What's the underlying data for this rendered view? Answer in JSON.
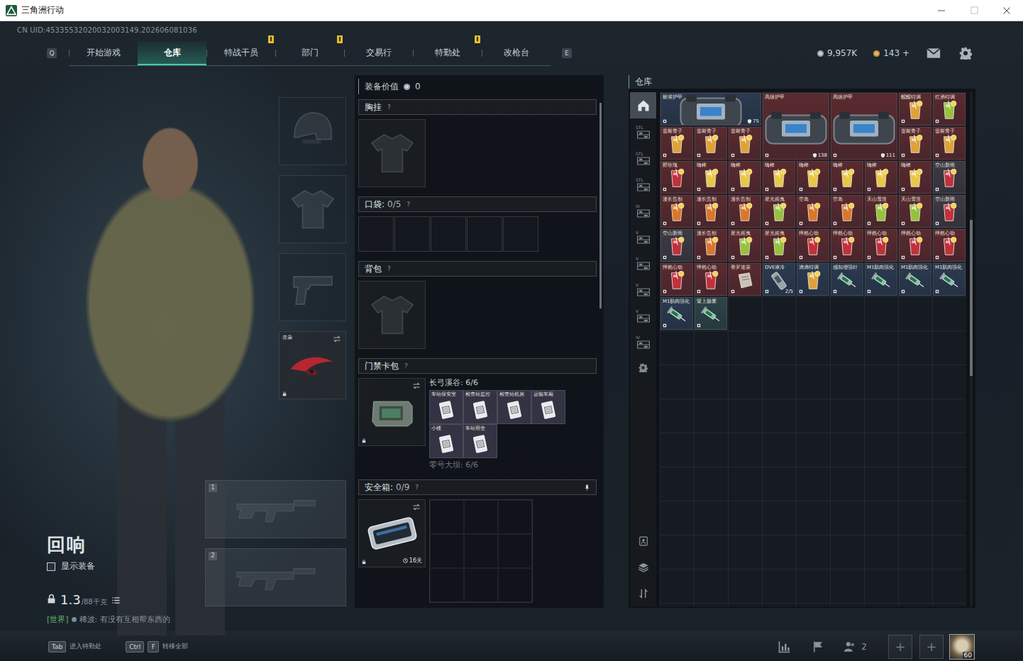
{
  "window": {
    "title": "三角洲行动"
  },
  "uid": "CN UID:45335532020032003149.202606081036",
  "nav": {
    "prev_key": "Q",
    "next_key": "E",
    "tabs": [
      {
        "label": "开始游戏",
        "selected": false,
        "badge": false
      },
      {
        "label": "仓库",
        "selected": true,
        "badge": false
      },
      {
        "label": "特战干员",
        "selected": false,
        "badge": true
      },
      {
        "label": "部门",
        "selected": false,
        "badge": true
      },
      {
        "label": "交易行",
        "selected": false,
        "badge": false
      },
      {
        "label": "特勤处",
        "selected": false,
        "badge": true
      },
      {
        "label": "改枪台",
        "selected": false,
        "badge": false
      }
    ]
  },
  "currency": [
    {
      "amount": "9,957K",
      "kind": "silver"
    },
    {
      "amount": "143 +",
      "kind": "gold"
    }
  ],
  "character": {
    "name": "回响",
    "show_equipment": {
      "label": "显示装备",
      "checked": false
    },
    "weight": "1.3",
    "weight_max": "/88千克"
  },
  "chat": {
    "channel": "[世界]",
    "sender": "稀波:",
    "message": "有没有互相帮东西的"
  },
  "gear_slots": [
    {
      "kind": "helmet",
      "filled": false
    },
    {
      "kind": "armor",
      "filled": false
    },
    {
      "kind": "pistol",
      "filled": false
    },
    {
      "kind": "melee",
      "filled": true,
      "label": "赤枭"
    }
  ],
  "weapon_slots": [
    {
      "number": "1",
      "filled": false
    },
    {
      "number": "2",
      "filled": false
    }
  ],
  "loadout": {
    "value_label": "装备价值",
    "value": "0",
    "chest": {
      "title": "胸挂",
      "help": "?",
      "filled": false
    },
    "pockets": {
      "title": "口袋:",
      "count": "0/5",
      "help": "?",
      "slots": [
        {
          "filled": false
        },
        {
          "filled": false
        },
        {
          "filled": false
        },
        {
          "filled": false
        },
        {
          "filled": false
        }
      ]
    },
    "backpack": {
      "title": "背包",
      "help": "?",
      "filled": false
    },
    "keycard": {
      "title": "门禁卡包",
      "help": "?",
      "groups": [
        {
          "name": "长弓溪谷: 6/6",
          "expanded": true,
          "cards": [
            {
              "label": "车站保安室"
            },
            {
              "label": "检查站监控"
            },
            {
              "label": "检查站机房"
            },
            {
              "label": "运输车厢"
            },
            {
              "label": "小楼"
            },
            {
              "label": "车站宿舍"
            }
          ]
        },
        {
          "name": "零号大坝: 6/6",
          "expanded": false,
          "cards": []
        }
      ]
    },
    "safe": {
      "title": "安全箱:",
      "count": "0/9",
      "help": "?",
      "expires": "16天",
      "pinned": true,
      "slots": [
        {
          "filled": false
        },
        {
          "filled": false
        },
        {
          "filled": false
        },
        {
          "filled": false
        },
        {
          "filled": false
        },
        {
          "filled": false
        },
        {
          "filled": false
        },
        {
          "filled": false
        },
        {
          "filled": false
        }
      ]
    }
  },
  "warehouse": {
    "title": "仓库",
    "tabs": [
      {
        "kind": "home",
        "label": "",
        "selected": true
      },
      {
        "kind": "shelf",
        "label": "STL",
        "selected": false
      },
      {
        "kind": "shelf",
        "label": "STL",
        "selected": false
      },
      {
        "kind": "shelf",
        "label": "STL",
        "selected": false
      },
      {
        "kind": "shelf",
        "label": "IV",
        "selected": false
      },
      {
        "kind": "shelf",
        "label": "V",
        "selected": false
      },
      {
        "kind": "shelf",
        "label": "V",
        "selected": false
      },
      {
        "kind": "shelf",
        "label": "V",
        "selected": false
      },
      {
        "kind": "shelf",
        "label": "V",
        "selected": false
      },
      {
        "kind": "shelf",
        "label": "IV",
        "selected": false
      },
      {
        "kind": "settings",
        "label": "",
        "selected": false
      }
    ],
    "items": [
      {
        "label": "标准护甲",
        "kind": "armor",
        "color": "#2b3a50",
        "cols": 3,
        "rows": 1,
        "durability": "75"
      },
      {
        "label": "高级护甲",
        "kind": "armor",
        "color": "#5a2a2f",
        "cols": 2,
        "rows": 2,
        "durability": "138"
      },
      {
        "label": "高级护甲",
        "kind": "armor",
        "color": "#5a2a2f",
        "cols": 2,
        "rows": 2,
        "durability": "111"
      },
      {
        "label": "醒醒特调",
        "kind": "drink",
        "color": "#5a2a2f",
        "cols": 1,
        "rows": 1
      },
      {
        "label": "红酒特调",
        "kind": "drink",
        "color": "#5a2a2f",
        "cols": 1,
        "rows": 1
      },
      {
        "label": "雷斯青子",
        "kind": "drink",
        "color": "#5a2a2f",
        "cols": 1,
        "rows": 1
      },
      {
        "label": "雷斯青子",
        "kind": "drink",
        "color": "#5a2a2f",
        "cols": 1,
        "rows": 1
      },
      {
        "label": "雷斯青子",
        "kind": "drink",
        "color": "#5a2a2f",
        "cols": 1,
        "rows": 1
      },
      {
        "label": "雷斯青子",
        "kind": "drink",
        "color": "#5a2a2f",
        "cols": 1,
        "rows": 1
      },
      {
        "label": "雷斯青子",
        "kind": "drink",
        "color": "#5a2a2f",
        "cols": 1,
        "rows": 1
      },
      {
        "label": "野玫瑰",
        "kind": "drink",
        "color": "#5a2a2f",
        "cols": 1,
        "rows": 1
      },
      {
        "label": "嗨棒",
        "kind": "drink",
        "color": "#5a2a2f",
        "cols": 1,
        "rows": 1
      },
      {
        "label": "嗨棒",
        "kind": "drink",
        "color": "#5a2a2f",
        "cols": 1,
        "rows": 1
      },
      {
        "label": "嗨棒",
        "kind": "drink",
        "color": "#5a2a2f",
        "cols": 1,
        "rows": 1
      },
      {
        "label": "嗨棒",
        "kind": "drink",
        "color": "#5a2a2f",
        "cols": 1,
        "rows": 1
      },
      {
        "label": "嗨棒",
        "kind": "drink",
        "color": "#5a2a2f",
        "cols": 1,
        "rows": 1
      },
      {
        "label": "嗨棒",
        "kind": "drink",
        "color": "#5a2a2f",
        "cols": 1,
        "rows": 1
      },
      {
        "label": "嗨棒",
        "kind": "drink",
        "color": "#5a2a2f",
        "cols": 1,
        "rows": 1
      },
      {
        "label": "空山新雨",
        "kind": "drink",
        "color": "#3e3a44",
        "cols": 1,
        "rows": 1
      },
      {
        "label": "漫长告别",
        "kind": "drink",
        "color": "#5a2a2f",
        "cols": 1,
        "rows": 1
      },
      {
        "label": "漫长告别",
        "kind": "drink",
        "color": "#5a2a2f",
        "cols": 1,
        "rows": 1
      },
      {
        "label": "漫长告别",
        "kind": "drink",
        "color": "#5a2a2f",
        "cols": 1,
        "rows": 1
      },
      {
        "label": "星光摇曳",
        "kind": "drink",
        "color": "#5a2a2f",
        "cols": 1,
        "rows": 1
      },
      {
        "label": "空岛",
        "kind": "drink",
        "color": "#5a2a2f",
        "cols": 1,
        "rows": 1
      },
      {
        "label": "空岛",
        "kind": "drink",
        "color": "#5a2a2f",
        "cols": 1,
        "rows": 1
      },
      {
        "label": "天山雪莲",
        "kind": "drink",
        "color": "#5a2a2f",
        "cols": 1,
        "rows": 1
      },
      {
        "label": "天山雪莲",
        "kind": "drink",
        "color": "#5a2a2f",
        "cols": 1,
        "rows": 1
      },
      {
        "label": "空山新雨",
        "kind": "drink",
        "color": "#3e3a44",
        "cols": 1,
        "rows": 1
      },
      {
        "label": "空山新雨",
        "kind": "drink",
        "color": "#3e3a44",
        "cols": 1,
        "rows": 1
      },
      {
        "label": "漫长告别",
        "kind": "drink",
        "color": "#5a2a2f",
        "cols": 1,
        "rows": 1
      },
      {
        "label": "星光摇曳",
        "kind": "drink",
        "color": "#5a2a2f",
        "cols": 1,
        "rows": 1
      },
      {
        "label": "星光摇曳",
        "kind": "drink",
        "color": "#5a2a2f",
        "cols": 1,
        "rows": 1
      },
      {
        "label": "怦然心动",
        "kind": "drink",
        "color": "#5a2a2f",
        "cols": 1,
        "rows": 1
      },
      {
        "label": "怦然心动",
        "kind": "drink",
        "color": "#5a2a2f",
        "cols": 1,
        "rows": 1
      },
      {
        "label": "怦然心动",
        "kind": "drink",
        "color": "#5a2a2f",
        "cols": 1,
        "rows": 1
      },
      {
        "label": "怦然心动",
        "kind": "drink",
        "color": "#5a2a2f",
        "cols": 1,
        "rows": 1
      },
      {
        "label": "怦然心动",
        "kind": "drink",
        "color": "#5a2a2f",
        "cols": 1,
        "rows": 1
      },
      {
        "label": "怦然心动",
        "kind": "drink",
        "color": "#5a2a2f",
        "cols": 1,
        "rows": 1
      },
      {
        "label": "怦然心动",
        "kind": "drink",
        "color": "#5a2a2f",
        "cols": 1,
        "rows": 1
      },
      {
        "label": "香罗迷茶",
        "kind": "pack",
        "color": "#5a2a2f",
        "cols": 1,
        "rows": 1
      },
      {
        "label": "DVE液冷",
        "kind": "device",
        "color": "#2b3a50",
        "cols": 1,
        "rows": 1,
        "count": "2/5"
      },
      {
        "label": "滴滴特调",
        "kind": "drink",
        "color": "#2b3a50",
        "cols": 1,
        "rows": 1
      },
      {
        "label": "感知增强针",
        "kind": "syringe",
        "color": "#2b3a50",
        "cols": 1,
        "rows": 1
      },
      {
        "label": "M1肌肉强化",
        "kind": "syringe",
        "color": "#2b3a50",
        "cols": 1,
        "rows": 1
      },
      {
        "label": "M1肌肉强化",
        "kind": "syringe",
        "color": "#2b3a50",
        "cols": 1,
        "rows": 1
      },
      {
        "label": "M1肌肉强化",
        "kind": "syringe",
        "color": "#2b3a50",
        "cols": 1,
        "rows": 1
      },
      {
        "label": "M1肌肉强化",
        "kind": "syringe",
        "color": "#2b3a50",
        "cols": 1,
        "rows": 1
      },
      {
        "label": "肾上腺素",
        "kind": "syringe",
        "color": "#2c4448",
        "cols": 1,
        "rows": 1
      }
    ]
  },
  "bottom": {
    "hints": [
      {
        "keys": [
          "Tab"
        ],
        "label": "进入特勤处"
      },
      {
        "keys": [
          "Ctrl",
          "F"
        ],
        "label": "转移全部"
      }
    ],
    "friends": "2",
    "invite_slots": [
      "+",
      "+"
    ],
    "level": "60"
  }
}
